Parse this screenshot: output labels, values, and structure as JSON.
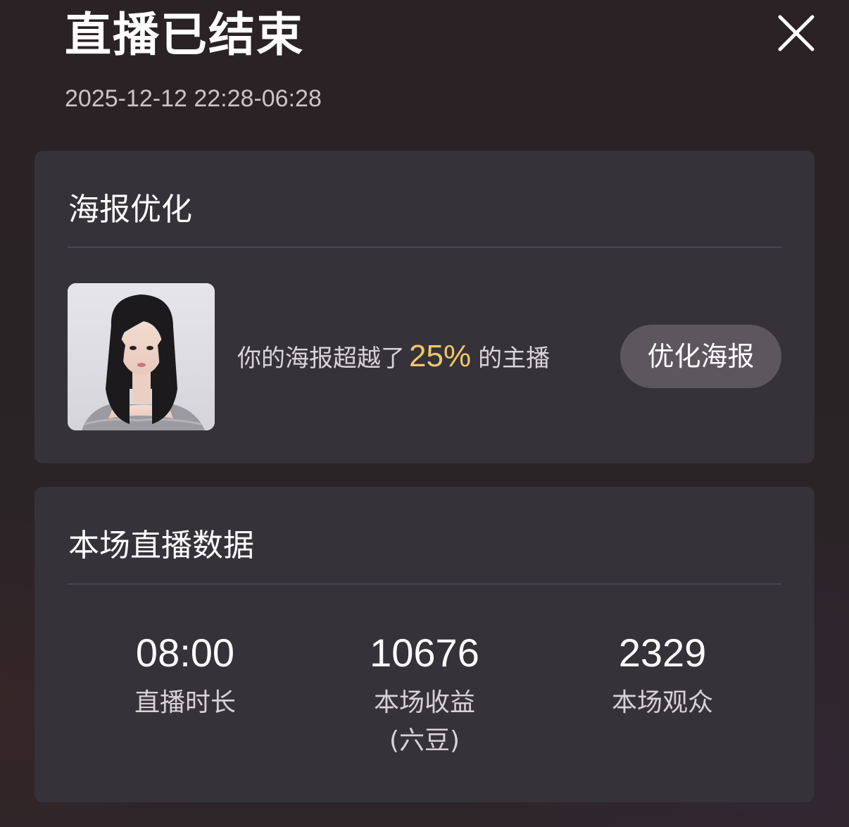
{
  "header": {
    "title": "直播已结束",
    "time_range": "2025-12-12 22:28-06:28"
  },
  "poster_card": {
    "title": "海报优化",
    "message_prefix": "你的海报超越了",
    "percent": "25%",
    "message_suffix": "的主播",
    "button_label": "优化海报"
  },
  "data_card": {
    "title": "本场直播数据",
    "stats": [
      {
        "value": "08:00",
        "label": "直播时长"
      },
      {
        "value": "10676",
        "label": "本场收益\n(六豆)"
      },
      {
        "value": "2329",
        "label": "本场观众"
      }
    ]
  },
  "icons": {
    "close": "close-icon",
    "poster": "poster-thumbnail"
  },
  "colors": {
    "accent_percent": "#f0c66d",
    "card_bg": "#353239",
    "button_bg": "#5e565e"
  }
}
